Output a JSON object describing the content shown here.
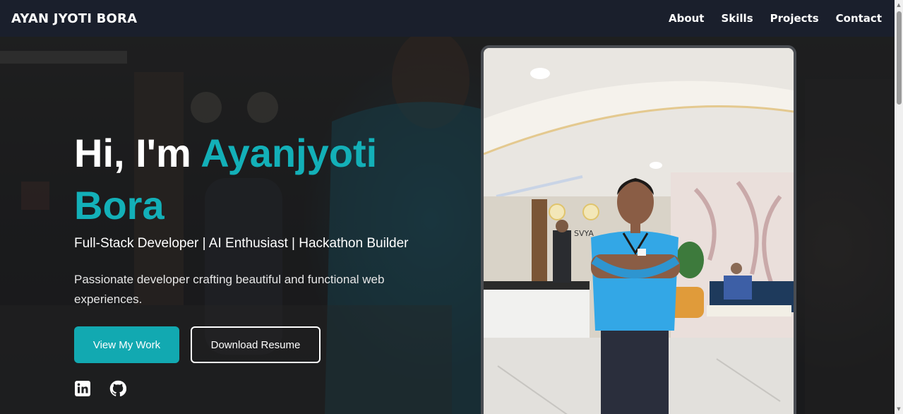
{
  "nav": {
    "brand": "AYAN JYOTI BORA",
    "links": [
      {
        "label": "About"
      },
      {
        "label": "Skills"
      },
      {
        "label": "Projects"
      },
      {
        "label": "Contact"
      }
    ]
  },
  "hero": {
    "greeting": "Hi, I'm ",
    "name": "Ayanjyoti Bora",
    "tagline": "Full-Stack Developer | AI Enthusiast | Hackathon Builder",
    "description": "Passionate developer crafting beautiful and functional web experiences.",
    "primary_button": "View My Work",
    "secondary_button": "Download Resume",
    "social": [
      {
        "icon": "linkedin-icon"
      },
      {
        "icon": "github-icon"
      }
    ]
  },
  "colors": {
    "accent": "#13b0b8",
    "navbar": "#1a1f2c"
  }
}
